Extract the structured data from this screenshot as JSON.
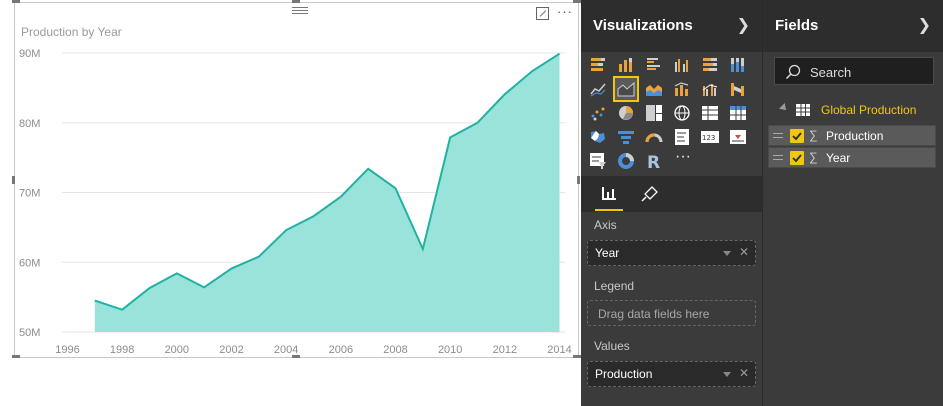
{
  "visual": {
    "title": "Production by Year"
  },
  "chart_data": {
    "type": "area",
    "title": "Production by Year",
    "xlabel": "",
    "ylabel": "",
    "x": [
      1997,
      1998,
      1999,
      2000,
      2001,
      2002,
      2003,
      2004,
      2005,
      2006,
      2007,
      2008,
      2009,
      2010,
      2011,
      2012,
      2013,
      2014
    ],
    "series": [
      {
        "values": [
          54.5,
          53.2,
          56.3,
          58.4,
          56.4,
          59.1,
          60.8,
          64.6,
          66.6,
          69.4,
          73.4,
          70.6,
          61.9,
          77.9,
          80.0,
          84.1,
          87.4,
          89.9
        ]
      }
    ],
    "xlim": [
      1995.8,
      2014.2
    ],
    "ylim": [
      50,
      90
    ],
    "xticks": [
      "1996",
      "1998",
      "2000",
      "2002",
      "2004",
      "2006",
      "2008",
      "2010",
      "2012",
      "2014"
    ],
    "yticks": [
      "50M",
      "60M",
      "70M",
      "80M",
      "90M"
    ],
    "ytick_values": [
      50,
      60,
      70,
      80,
      90
    ],
    "xtick_values": [
      1996,
      1998,
      2000,
      2002,
      2004,
      2006,
      2008,
      2010,
      2012,
      2014
    ],
    "grid": true,
    "colors": {
      "area": "#9ae3da",
      "line": "#1fb2a3",
      "grid": "#e6e6e6",
      "tick": "#8c8c8c"
    }
  },
  "visualizations": {
    "title": "Visualizations",
    "tabs": [
      "fields-tab",
      "format-tab"
    ],
    "wells": [
      {
        "label": "Axis",
        "value": "Year",
        "placeholder": ""
      },
      {
        "label": "Legend",
        "value": "",
        "placeholder": "Drag data fields here"
      },
      {
        "label": "Values",
        "value": "Production",
        "placeholder": ""
      }
    ],
    "more": "···",
    "r_visual": "R"
  },
  "fields": {
    "title": "Fields",
    "search_placeholder": "Search",
    "table": "Global Production",
    "items": [
      {
        "name": "Production",
        "checked": true
      },
      {
        "name": "Year",
        "checked": true
      }
    ]
  },
  "colors": {
    "accent": "#f2c80f",
    "pane": "#3b3b3b",
    "pane_header": "#2d2d2d"
  }
}
